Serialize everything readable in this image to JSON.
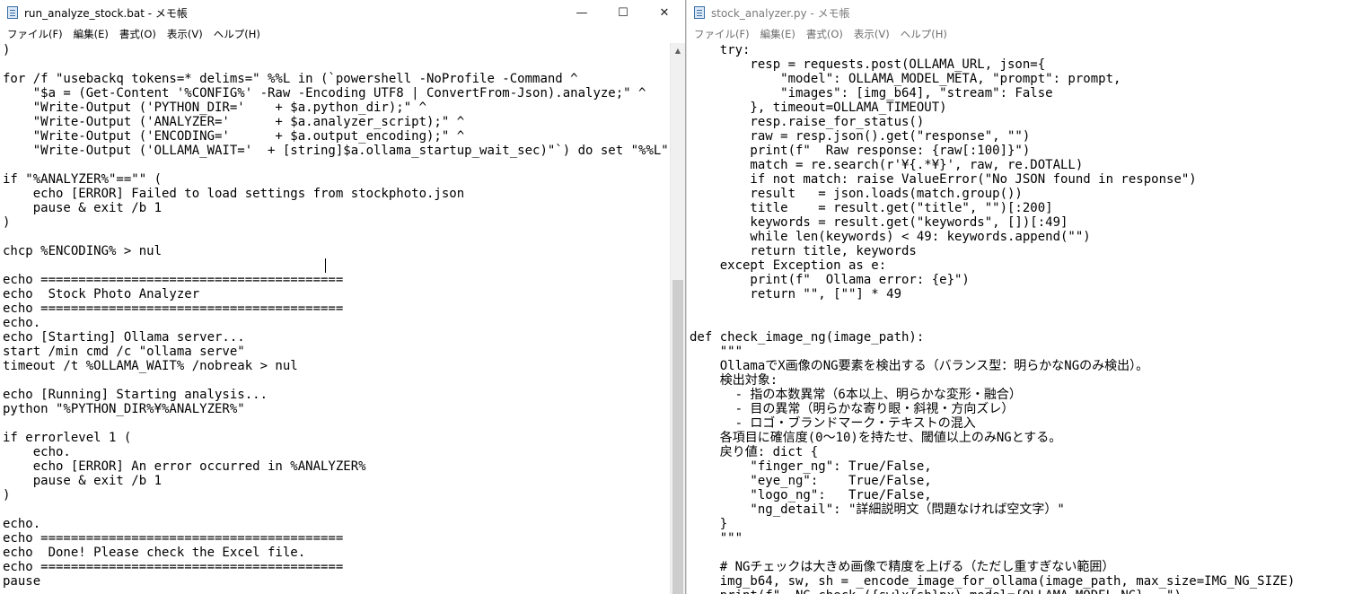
{
  "left_window": {
    "title": "run_analyze_stock.bat - メモ帳",
    "menu": [
      "ファイル(F)",
      "編集(E)",
      "書式(O)",
      "表示(V)",
      "ヘルプ(H)"
    ],
    "buttons": {
      "minimize": "—",
      "maximize": "☐",
      "close": "✕"
    },
    "lines": [
      ")",
      "",
      "for /f \"usebackq tokens=* delims=\" %%L in (`powershell -NoProfile -Command ^",
      "    \"$a = (Get-Content '%CONFIG%' -Raw -Encoding UTF8 | ConvertFrom-Json).analyze;\" ^",
      "    \"Write-Output ('PYTHON_DIR='    + $a.python_dir);\" ^",
      "    \"Write-Output ('ANALYZER='      + $a.analyzer_script);\" ^",
      "    \"Write-Output ('ENCODING='      + $a.output_encoding);\" ^",
      "    \"Write-Output ('OLLAMA_WAIT='  + [string]$a.ollama_startup_wait_sec)\"`) do set \"%%L\"",
      "",
      "if \"%ANALYZER%\"==\"\" (",
      "    echo [ERROR] Failed to load settings from stockphoto.json",
      "    pause & exit /b 1",
      ")",
      "",
      "chcp %ENCODING% > nul",
      "",
      "echo ========================================",
      "echo  Stock Photo Analyzer",
      "echo ========================================",
      "echo.",
      "echo [Starting] Ollama server...",
      "start /min cmd /c \"ollama serve\"",
      "timeout /t %OLLAMA_WAIT% /nobreak > nul",
      "",
      "echo [Running] Starting analysis...",
      "python \"%PYTHON_DIR%¥%ANALYZER%\"",
      "",
      "if errorlevel 1 (",
      "    echo.",
      "    echo [ERROR] An error occurred in %ANALYZER%",
      "    pause & exit /b 1",
      ")",
      "",
      "echo.",
      "echo ========================================",
      "echo  Done! Please check the Excel file.",
      "echo ========================================",
      "pause"
    ]
  },
  "right_window": {
    "title": "stock_analyzer.py - メモ帳",
    "menu": [
      "ファイル(F)",
      "編集(E)",
      "書式(O)",
      "表示(V)",
      "ヘルプ(H)"
    ],
    "lines": [
      "    try:",
      "        resp = requests.post(OLLAMA_URL, json={",
      "            \"model\": OLLAMA_MODEL_META, \"prompt\": prompt,",
      "            \"images\": [img_b64], \"stream\": False",
      "        }, timeout=OLLAMA_TIMEOUT)",
      "        resp.raise_for_status()",
      "        raw = resp.json().get(\"response\", \"\")",
      "        print(f\"  Raw response: {raw[:100]}\")",
      "        match = re.search(r'¥{.*¥}', raw, re.DOTALL)",
      "        if not match: raise ValueError(\"No JSON found in response\")",
      "        result   = json.loads(match.group())",
      "        title    = result.get(\"title\", \"\")[:200]",
      "        keywords = result.get(\"keywords\", [])[:49]",
      "        while len(keywords) < 49: keywords.append(\"\")",
      "        return title, keywords",
      "    except Exception as e:",
      "        print(f\"  Ollama error: {e}\")",
      "        return \"\", [\"\"] * 49",
      "",
      "",
      "def check_image_ng(image_path):",
      "    \"\"\"",
      "    OllamaでX画像のNG要素を検出する（バランス型：明らかなNGのみ検出）。",
      "    検出対象:",
      "      - 指の本数異常（6本以上、明らかな変形・融合）",
      "      - 目の異常（明らかな寄り眼・斜視・方向ズレ）",
      "      - ロゴ・ブランドマーク・テキストの混入",
      "    各項目に確信度(0～10)を持たせ、閾値以上のみNGとする。",
      "    戻り値: dict {",
      "        \"finger_ng\": True/False,",
      "        \"eye_ng\":    True/False,",
      "        \"logo_ng\":   True/False,",
      "        \"ng_detail\": \"詳細説明文（問題なければ空文字）\"",
      "    }",
      "    \"\"\"",
      "",
      "    # NGチェックは大きめ画像で精度を上げる（ただし重すぎない範囲）",
      "    img_b64, sw, sh = _encode_image_for_ollama(image_path, max_size=IMG_NG_SIZE)",
      "    print(f\"  NG check ({sw}x{sh}px) model={OLLAMA_MODEL_NG}...\")"
    ]
  }
}
